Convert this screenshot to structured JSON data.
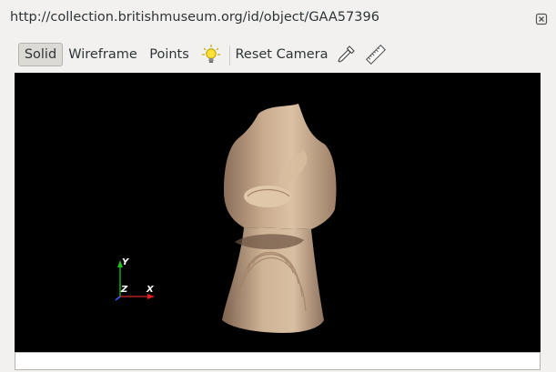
{
  "window": {
    "title": "http://collection.britishmuseum.org/id/object/GAA57396"
  },
  "toolbar": {
    "solid_label": "Solid",
    "wireframe_label": "Wireframe",
    "points_label": "Points",
    "reset_camera_label": "Reset Camera",
    "active_mode": "Solid",
    "icons": [
      "lightbulb-icon",
      "eyedropper-icon",
      "ruler-icon"
    ]
  },
  "viewport": {
    "background": "#000000",
    "axes": {
      "y": "Y",
      "z": "Z",
      "x": "X"
    },
    "axis_colors": {
      "x": "#e02020",
      "y": "#20c020",
      "z": "#3060ff"
    }
  },
  "status": {
    "text": ""
  }
}
